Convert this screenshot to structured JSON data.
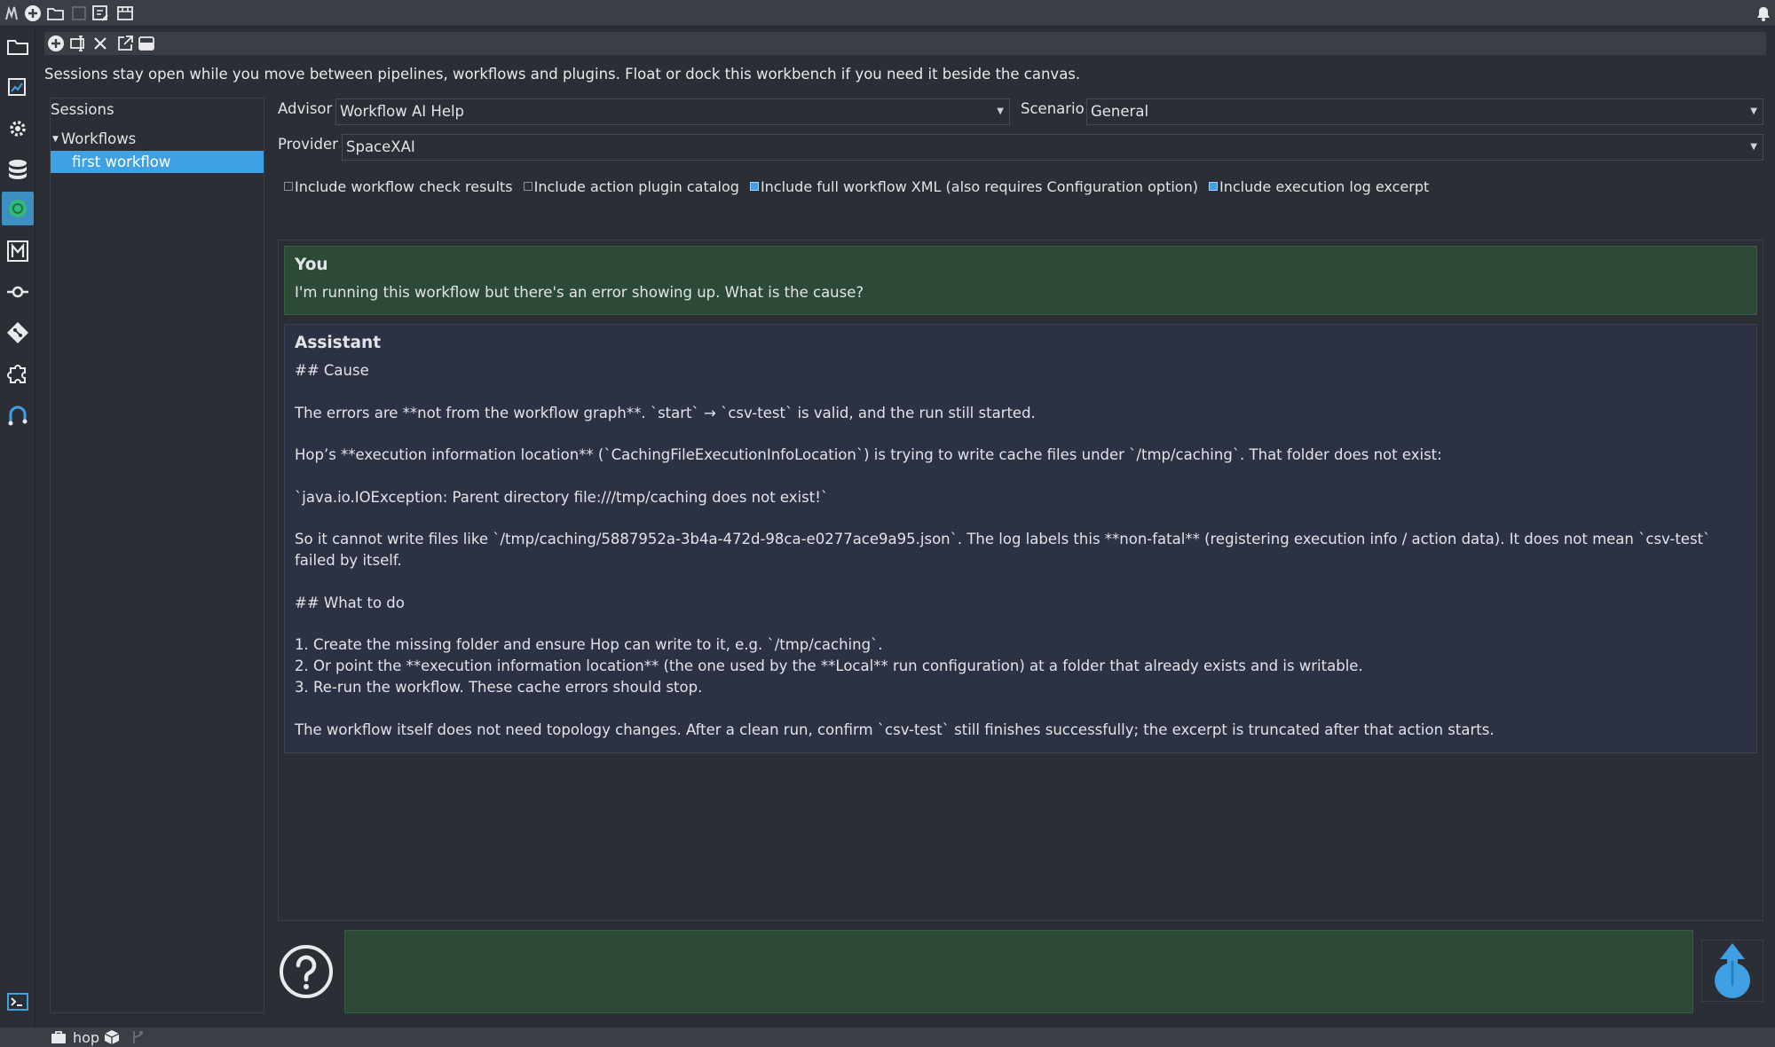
{
  "session_hint": "Sessions stay open while you move between pipelines, workflows and plugins. Float or dock this workbench if you need it beside the canvas.",
  "sessions": {
    "label": "Sessions",
    "group": "Workflows",
    "selected_item": "first workflow"
  },
  "form": {
    "advisor_label": "Advisor",
    "advisor_value": "Workflow AI Help",
    "scenario_label": "Scenario",
    "scenario_value": "General",
    "provider_label": "Provider",
    "provider_value": "SpaceXAI"
  },
  "options": [
    {
      "label": "Include workflow check results",
      "checked": false
    },
    {
      "label": "Include action plugin catalog",
      "checked": false
    },
    {
      "label": "Include full workflow XML (also requires Configuration option)",
      "checked": true
    },
    {
      "label": "Include execution log excerpt",
      "checked": true
    }
  ],
  "conversation": {
    "user": {
      "who": "You",
      "text": "I'm running this workflow but there's an error showing up. What is the cause?"
    },
    "assistant": {
      "who": "Assistant",
      "text": "## Cause\n\nThe errors are **not from the workflow graph**. `start` → `csv-test` is valid, and the run still started.\n\nHop’s **execution information location** (`CachingFileExecutionInfoLocation`) is trying to write cache files under `/tmp/caching`. That folder does not exist:\n\n`java.io.IOException: Parent directory file:///tmp/caching does not exist!`\n\nSo it cannot write files like `/tmp/caching/5887952a-3b4a-472d-98ca-e0277ace9a95.json`. The log labels this **non-fatal** (registering execution info / action data). It does not mean `csv-test` failed by itself.\n\n## What to do\n\n1. Create the missing folder and ensure Hop can write to it, e.g. `/tmp/caching`.\n2. Or point the **execution information location** (the one used by the **Local** run configuration) at a folder that already exists and is writable.\n3. Re-run the workflow. These cache errors should stop.\n\nThe workflow itself does not need topology changes. After a clean run, confirm `csv-test` still finishes successfully; the excerpt is truncated after that action starts."
    }
  },
  "status_bar": {
    "project": "hop"
  },
  "colors": {
    "accent": "#3fa1e3",
    "user_bubble": "#2c4a37",
    "assistant_bubble": "#2c3144"
  }
}
